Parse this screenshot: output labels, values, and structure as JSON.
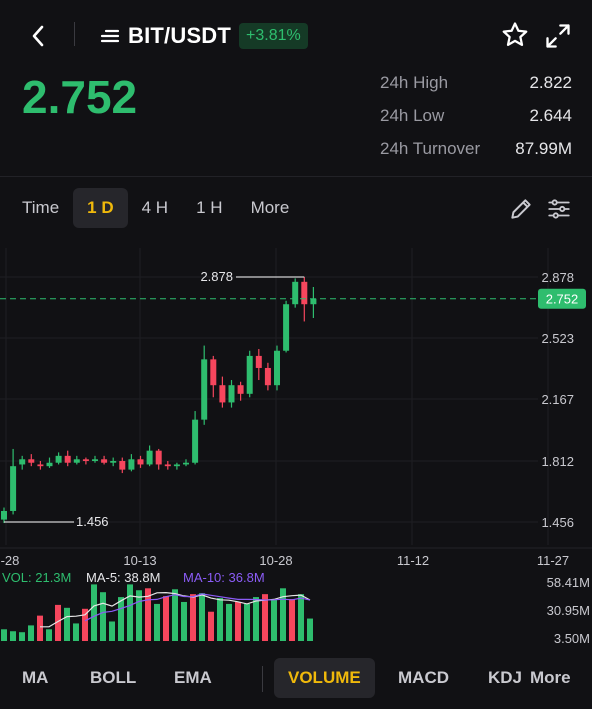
{
  "header": {
    "pair": "BIT/USDT",
    "change_pct": "+3.81%",
    "icons": [
      "back-icon",
      "menu-lines-icon",
      "star-icon",
      "expand-icon"
    ]
  },
  "ticker": {
    "price": "2.752",
    "stats": [
      {
        "label": "24h High",
        "value": "2.822"
      },
      {
        "label": "24h Low",
        "value": "2.644"
      },
      {
        "label": "24h Turnover",
        "value": "87.99M"
      }
    ]
  },
  "intervals": {
    "items": [
      "Time",
      "1 D",
      "4 H",
      "1 H",
      "More"
    ],
    "active": "1 D"
  },
  "chart_data": {
    "type": "candlestick",
    "price_axis": [
      "2.878",
      "2.523",
      "2.167",
      "1.812",
      "1.456"
    ],
    "current_price_label": "2.752",
    "high_marker": "2.878",
    "low_marker": "1.456",
    "date_axis": [
      "-28",
      "10-13",
      "10-28",
      "11-12",
      "11-27"
    ],
    "volume_legend": {
      "vol": "VOL: 21.3M",
      "ma5": "MA-5: 38.8M",
      "ma10": "MA-10: 36.8M"
    },
    "volume_axis": [
      "58.41M",
      "30.95M",
      "3.50M"
    ],
    "colors": {
      "up": "#2ebd6e",
      "down": "#f6465d",
      "ma5": "#e6e6e6",
      "ma10": "#8b5cf6"
    },
    "candles": [
      {
        "o": 1.47,
        "c": 1.52,
        "h": 1.54,
        "l": 1.45
      },
      {
        "o": 1.52,
        "c": 1.78,
        "h": 1.88,
        "l": 1.5
      },
      {
        "o": 1.79,
        "c": 1.82,
        "h": 1.84,
        "l": 1.76
      },
      {
        "o": 1.82,
        "c": 1.8,
        "h": 1.85,
        "l": 1.78
      },
      {
        "o": 1.79,
        "c": 1.78,
        "h": 1.81,
        "l": 1.76
      },
      {
        "o": 1.78,
        "c": 1.8,
        "h": 1.83,
        "l": 1.77
      },
      {
        "o": 1.8,
        "c": 1.84,
        "h": 1.86,
        "l": 1.79
      },
      {
        "o": 1.84,
        "c": 1.8,
        "h": 1.87,
        "l": 1.78
      },
      {
        "o": 1.8,
        "c": 1.82,
        "h": 1.84,
        "l": 1.79
      },
      {
        "o": 1.82,
        "c": 1.81,
        "h": 1.83,
        "l": 1.79
      },
      {
        "o": 1.81,
        "c": 1.82,
        "h": 1.84,
        "l": 1.8
      },
      {
        "o": 1.82,
        "c": 1.8,
        "h": 1.84,
        "l": 1.79
      },
      {
        "o": 1.8,
        "c": 1.81,
        "h": 1.83,
        "l": 1.78
      },
      {
        "o": 1.81,
        "c": 1.76,
        "h": 1.83,
        "l": 1.74
      },
      {
        "o": 1.76,
        "c": 1.82,
        "h": 1.85,
        "l": 1.75
      },
      {
        "o": 1.82,
        "c": 1.79,
        "h": 1.84,
        "l": 1.77
      },
      {
        "o": 1.79,
        "c": 1.87,
        "h": 1.9,
        "l": 1.78
      },
      {
        "o": 1.87,
        "c": 1.79,
        "h": 1.88,
        "l": 1.76
      },
      {
        "o": 1.79,
        "c": 1.78,
        "h": 1.81,
        "l": 1.76
      },
      {
        "o": 1.78,
        "c": 1.79,
        "h": 1.8,
        "l": 1.76
      },
      {
        "o": 1.79,
        "c": 1.8,
        "h": 1.82,
        "l": 1.78
      },
      {
        "o": 1.8,
        "c": 2.05,
        "h": 2.1,
        "l": 1.79
      },
      {
        "o": 2.05,
        "c": 2.4,
        "h": 2.48,
        "l": 2.02
      },
      {
        "o": 2.4,
        "c": 2.25,
        "h": 2.42,
        "l": 2.18
      },
      {
        "o": 2.25,
        "c": 2.15,
        "h": 2.3,
        "l": 2.12
      },
      {
        "o": 2.15,
        "c": 2.25,
        "h": 2.28,
        "l": 2.12
      },
      {
        "o": 2.25,
        "c": 2.2,
        "h": 2.27,
        "l": 2.16
      },
      {
        "o": 2.2,
        "c": 2.42,
        "h": 2.45,
        "l": 2.18
      },
      {
        "o": 2.42,
        "c": 2.35,
        "h": 2.46,
        "l": 2.28
      },
      {
        "o": 2.35,
        "c": 2.25,
        "h": 2.38,
        "l": 2.22
      },
      {
        "o": 2.25,
        "c": 2.45,
        "h": 2.48,
        "l": 2.22
      },
      {
        "o": 2.45,
        "c": 2.72,
        "h": 2.74,
        "l": 2.44
      },
      {
        "o": 2.72,
        "c": 2.85,
        "h": 2.87,
        "l": 2.7
      },
      {
        "o": 2.85,
        "c": 2.72,
        "h": 2.878,
        "l": 2.62
      },
      {
        "o": 2.72,
        "c": 2.752,
        "h": 2.82,
        "l": 2.64
      }
    ],
    "volumes": [
      {
        "v": 12,
        "up": true
      },
      {
        "v": 10,
        "up": true
      },
      {
        "v": 9,
        "up": true
      },
      {
        "v": 16,
        "up": true
      },
      {
        "v": 26,
        "up": false
      },
      {
        "v": 12,
        "up": true
      },
      {
        "v": 37,
        "up": false
      },
      {
        "v": 34,
        "up": true
      },
      {
        "v": 18,
        "up": true
      },
      {
        "v": 33,
        "up": false
      },
      {
        "v": 58,
        "up": true
      },
      {
        "v": 50,
        "up": true
      },
      {
        "v": 20,
        "up": true
      },
      {
        "v": 45,
        "up": true
      },
      {
        "v": 58,
        "up": true
      },
      {
        "v": 52,
        "up": true
      },
      {
        "v": 54,
        "up": false
      },
      {
        "v": 38,
        "up": true
      },
      {
        "v": 46,
        "up": false
      },
      {
        "v": 53,
        "up": true
      },
      {
        "v": 40,
        "up": true
      },
      {
        "v": 48,
        "up": false
      },
      {
        "v": 49,
        "up": true
      },
      {
        "v": 30,
        "up": false
      },
      {
        "v": 44,
        "up": true
      },
      {
        "v": 38,
        "up": true
      },
      {
        "v": 40,
        "up": false
      },
      {
        "v": 38,
        "up": true
      },
      {
        "v": 45,
        "up": true
      },
      {
        "v": 48,
        "up": false
      },
      {
        "v": 42,
        "up": true
      },
      {
        "v": 54,
        "up": true
      },
      {
        "v": 43,
        "up": false
      },
      {
        "v": 48,
        "up": true
      },
      {
        "v": 23,
        "up": true
      }
    ]
  },
  "indicators": {
    "items": [
      "MA",
      "BOLL",
      "EMA",
      "VOLUME",
      "MACD",
      "KDJ",
      "More"
    ],
    "active": "VOLUME"
  }
}
